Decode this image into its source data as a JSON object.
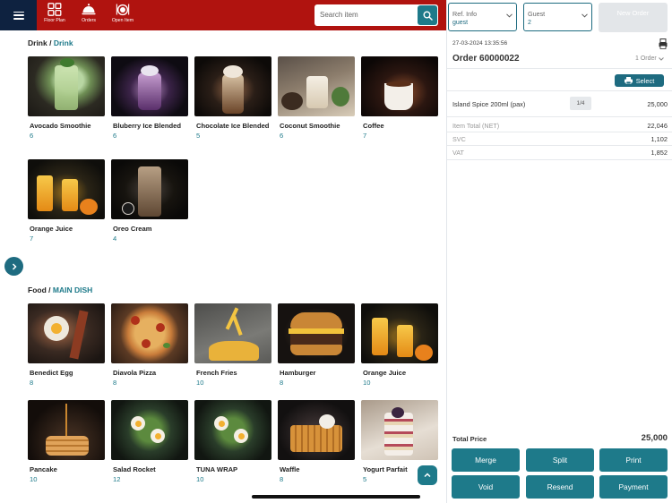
{
  "topbar": {
    "nav": [
      {
        "label": "Floor Plan",
        "icon": "floor-plan-icon"
      },
      {
        "label": "Orders",
        "icon": "cloche-icon"
      },
      {
        "label": "Open Item",
        "icon": "plate-cutlery-icon"
      }
    ],
    "search_placeholder": "Search item",
    "colors": {
      "bar": "#b0130f",
      "menu": "#0e2240",
      "accent": "#1e7a8a"
    }
  },
  "drink": {
    "category": "Drink",
    "subcategory": "Drink",
    "items": [
      {
        "name": "Avocado Smoothie",
        "count": "6"
      },
      {
        "name": "Bluberry Ice Blended",
        "count": "6"
      },
      {
        "name": "Chocolate  Ice Blended",
        "count": "5"
      },
      {
        "name": "Coconut Smoothie",
        "count": "6"
      },
      {
        "name": "Coffee",
        "count": "7"
      },
      {
        "name": "Orange Juice",
        "count": "7"
      },
      {
        "name": "Oreo Cream",
        "count": "4"
      }
    ]
  },
  "food": {
    "category": "Food",
    "subcategory": "MAIN DISH",
    "items": [
      {
        "name": "Benedict Egg",
        "count": "8"
      },
      {
        "name": "Diavola Pizza",
        "count": "8"
      },
      {
        "name": "French Fries",
        "count": "10"
      },
      {
        "name": "Hamburger",
        "count": "8"
      },
      {
        "name": "Orange Juice",
        "count": "10"
      },
      {
        "name": "Pancake",
        "count": "10"
      },
      {
        "name": "Salad Rocket",
        "count": "12"
      },
      {
        "name": "TUNA WRAP",
        "count": "10"
      },
      {
        "name": "Waffle",
        "count": "8"
      },
      {
        "name": "Yogurt Parfait",
        "count": "5"
      }
    ]
  },
  "order": {
    "ref_label": "Ref. Info",
    "ref_value": "guest",
    "guest_label": "Guest",
    "guest_value": "2",
    "new_order_label": "New Order",
    "datetime": "27-03-2024 13:35:56",
    "order_no": "Order 60000022",
    "order_count": "1 Order",
    "select_label": "Select",
    "line_items": [
      {
        "name": "Island Spice 200ml (pax)",
        "qty": "1/4",
        "amount": "25,000"
      }
    ],
    "totals": [
      {
        "label": "Item Total (NET)",
        "value": "22,046"
      },
      {
        "label": "SVC",
        "value": "1,102"
      },
      {
        "label": "VAT",
        "value": "1,852"
      }
    ],
    "total_price_label": "Total Price",
    "total_price": "25,000",
    "actions": [
      "Merge",
      "Split",
      "Print",
      "Void",
      "Resend",
      "Payment"
    ]
  }
}
